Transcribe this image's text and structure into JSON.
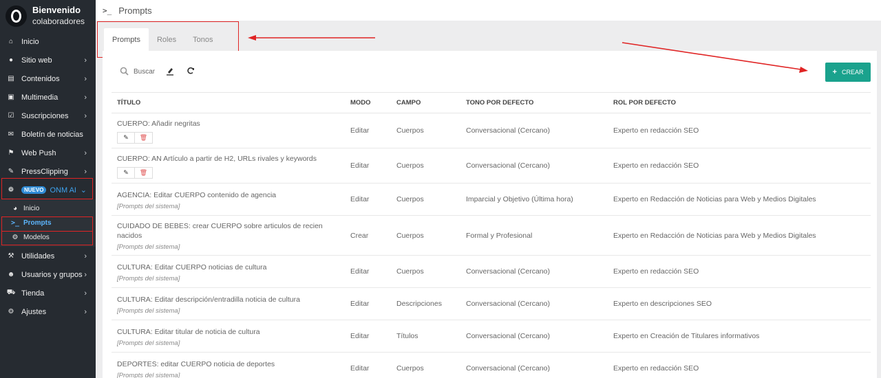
{
  "sidebar": {
    "welcome_line1": "Bienvenido",
    "welcome_line2": "colaboradores",
    "items": [
      {
        "label": "Inicio",
        "icon": "home-icon",
        "chevron": false
      },
      {
        "label": "Sitio web",
        "icon": "globe-icon",
        "chevron": true
      },
      {
        "label": "Contenidos",
        "icon": "newspaper-icon",
        "chevron": true
      },
      {
        "label": "Multimedia",
        "icon": "image-icon",
        "chevron": true
      },
      {
        "label": "Suscripciones",
        "icon": "check-square-icon",
        "chevron": true
      },
      {
        "label": "Boletín de noticias",
        "icon": "envelope-icon",
        "chevron": false
      },
      {
        "label": "Web Push",
        "icon": "bell-icon",
        "chevron": true
      },
      {
        "label": "PressClipping",
        "icon": "paperclip-icon",
        "chevron": true
      }
    ],
    "onm": {
      "badge": "NUEVO",
      "label": "ONM AI",
      "icon": "openai-icon"
    },
    "sub_items": [
      {
        "label": "Inicio",
        "icon": "dashboard-icon"
      },
      {
        "label": "Prompts",
        "icon": "terminal-icon"
      },
      {
        "label": "Modelos",
        "icon": "cogs-icon"
      }
    ],
    "items_after": [
      {
        "label": "Utilidades",
        "icon": "wrench-icon",
        "chevron": true
      },
      {
        "label": "Usuarios y grupos",
        "icon": "users-icon",
        "chevron": true
      },
      {
        "label": "Tienda",
        "icon": "cart-icon",
        "chevron": true
      },
      {
        "label": "Ajustes",
        "icon": "gears-icon",
        "chevron": true
      }
    ]
  },
  "header": {
    "title": "Prompts",
    "icon": "terminal-icon"
  },
  "tabs": [
    {
      "label": "Prompts",
      "active": true
    },
    {
      "label": "Roles",
      "active": false
    },
    {
      "label": "Tonos",
      "active": false
    }
  ],
  "toolbar": {
    "search_label": "Buscar",
    "icons": [
      "search-icon",
      "eraser-icon",
      "refresh-icon"
    ]
  },
  "create_button": {
    "label": "CREAR"
  },
  "table": {
    "columns": [
      "TÍTULO",
      "MODO",
      "CAMPO",
      "TONO POR DEFECTO",
      "ROL POR DEFECTO"
    ],
    "rows": [
      {
        "title": "CUERPO: Añadir negritas",
        "sub": "",
        "actions": true,
        "mode": "Editar",
        "field": "Cuerpos",
        "tone": "Conversacional (Cercano)",
        "role": "Experto en redacción SEO"
      },
      {
        "title": "CUERPO: AN Artículo a partir de H2, URLs rivales y keywords",
        "sub": "",
        "actions": true,
        "mode": "Editar",
        "field": "Cuerpos",
        "tone": "Conversacional (Cercano)",
        "role": "Experto en redacción SEO"
      },
      {
        "title": "AGENCIA: Editar CUERPO contenido de agencia",
        "sub": "[Prompts del sistema]",
        "actions": false,
        "mode": "Editar",
        "field": "Cuerpos",
        "tone": "Imparcial y Objetivo (Última hora)",
        "role": "Experto en Redacción de Noticias para Web y Medios Digitales"
      },
      {
        "title": "CUIDADO DE BEBES: crear CUERPO sobre articulos de recien nacidos",
        "sub": "[Prompts del sistema]",
        "actions": false,
        "mode": "Crear",
        "field": "Cuerpos",
        "tone": "Formal y Profesional",
        "role": "Experto en Redacción de Noticias para Web y Medios Digitales"
      },
      {
        "title": "CULTURA: Editar CUERPO noticias de cultura",
        "sub": "[Prompts del sistema]",
        "actions": false,
        "mode": "Editar",
        "field": "Cuerpos",
        "tone": "Conversacional (Cercano)",
        "role": "Experto en redacción SEO"
      },
      {
        "title": "CULTURA: Editar descripción/entradilla noticia de cultura",
        "sub": "[Prompts del sistema]",
        "actions": false,
        "mode": "Editar",
        "field": "Descripciones",
        "tone": "Conversacional (Cercano)",
        "role": "Experto en descripciones SEO"
      },
      {
        "title": "CULTURA: Editar titular de noticia de cultura",
        "sub": "[Prompts del sistema]",
        "actions": false,
        "mode": "Editar",
        "field": "Títulos",
        "tone": "Conversacional (Cercano)",
        "role": "Experto en Creación de Titulares informativos"
      },
      {
        "title": "DEPORTES: editar CUERPO noticia de deportes",
        "sub": "[Prompts del sistema]",
        "actions": false,
        "mode": "Editar",
        "field": "Cuerpos",
        "tone": "Conversacional (Cercano)",
        "role": "Experto en redacción SEO"
      }
    ]
  },
  "colors": {
    "accent": "#1aa28d",
    "sidebar_bg": "#262b31",
    "highlight": "#e02424",
    "onm_blue": "#3fa3ef"
  }
}
